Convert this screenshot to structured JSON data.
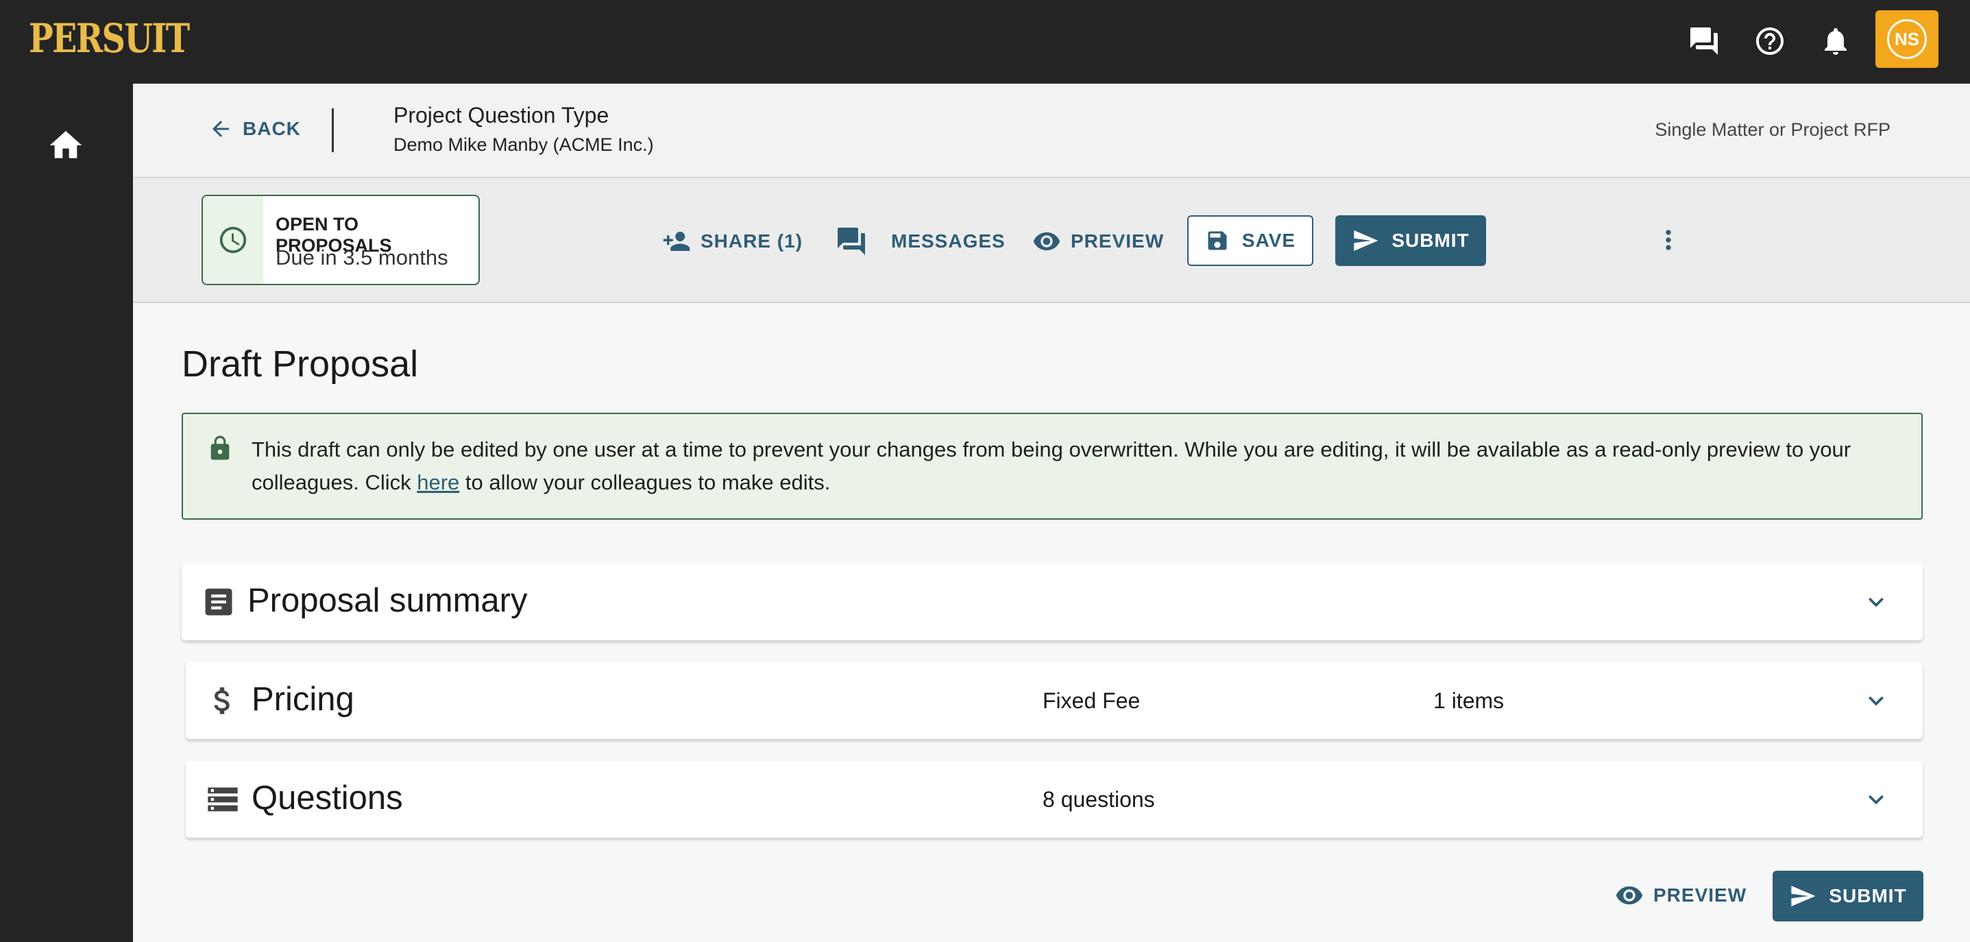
{
  "app": {
    "logo_text": "PERSUIT",
    "avatar_initials": "NS",
    "top_icons": [
      "chat-icon",
      "help-icon",
      "bell-icon"
    ],
    "accent_color": "#e9bb4a",
    "avatar_color": "#f2a71d"
  },
  "header": {
    "back_label": "BACK",
    "project_title": "Project Question Type",
    "project_subtitle": "Demo Mike Manby (ACME Inc.)",
    "rfp_type": "Single Matter or Project RFP"
  },
  "toolbar": {
    "status_title": "OPEN TO PROPOSALS",
    "status_due": "Due in 3.5 months",
    "share_label": "SHARE (1)",
    "messages_label": "MESSAGES",
    "preview_label": "PREVIEW",
    "save_label": "SAVE",
    "submit_label": "SUBMIT",
    "primary_color": "#2d5d75",
    "status_color": "#3d6b4a"
  },
  "main": {
    "page_title": "Draft Proposal",
    "notice_before": "This draft can only be edited by one user at a time to prevent your changes from being overwritten. While you are editing, it will be available as a read-only preview to your colleagues. Click ",
    "notice_link": "here",
    "notice_after": " to allow your colleagues to make edits.",
    "sections": [
      {
        "title": "Proposal summary",
        "col1": "",
        "col2": ""
      },
      {
        "title": "Pricing",
        "col1": "Fixed Fee",
        "col2": "1 items"
      },
      {
        "title": "Questions",
        "col1": "8 questions",
        "col2": ""
      }
    ]
  },
  "footer": {
    "preview_label": "PREVIEW",
    "submit_label": "SUBMIT"
  }
}
